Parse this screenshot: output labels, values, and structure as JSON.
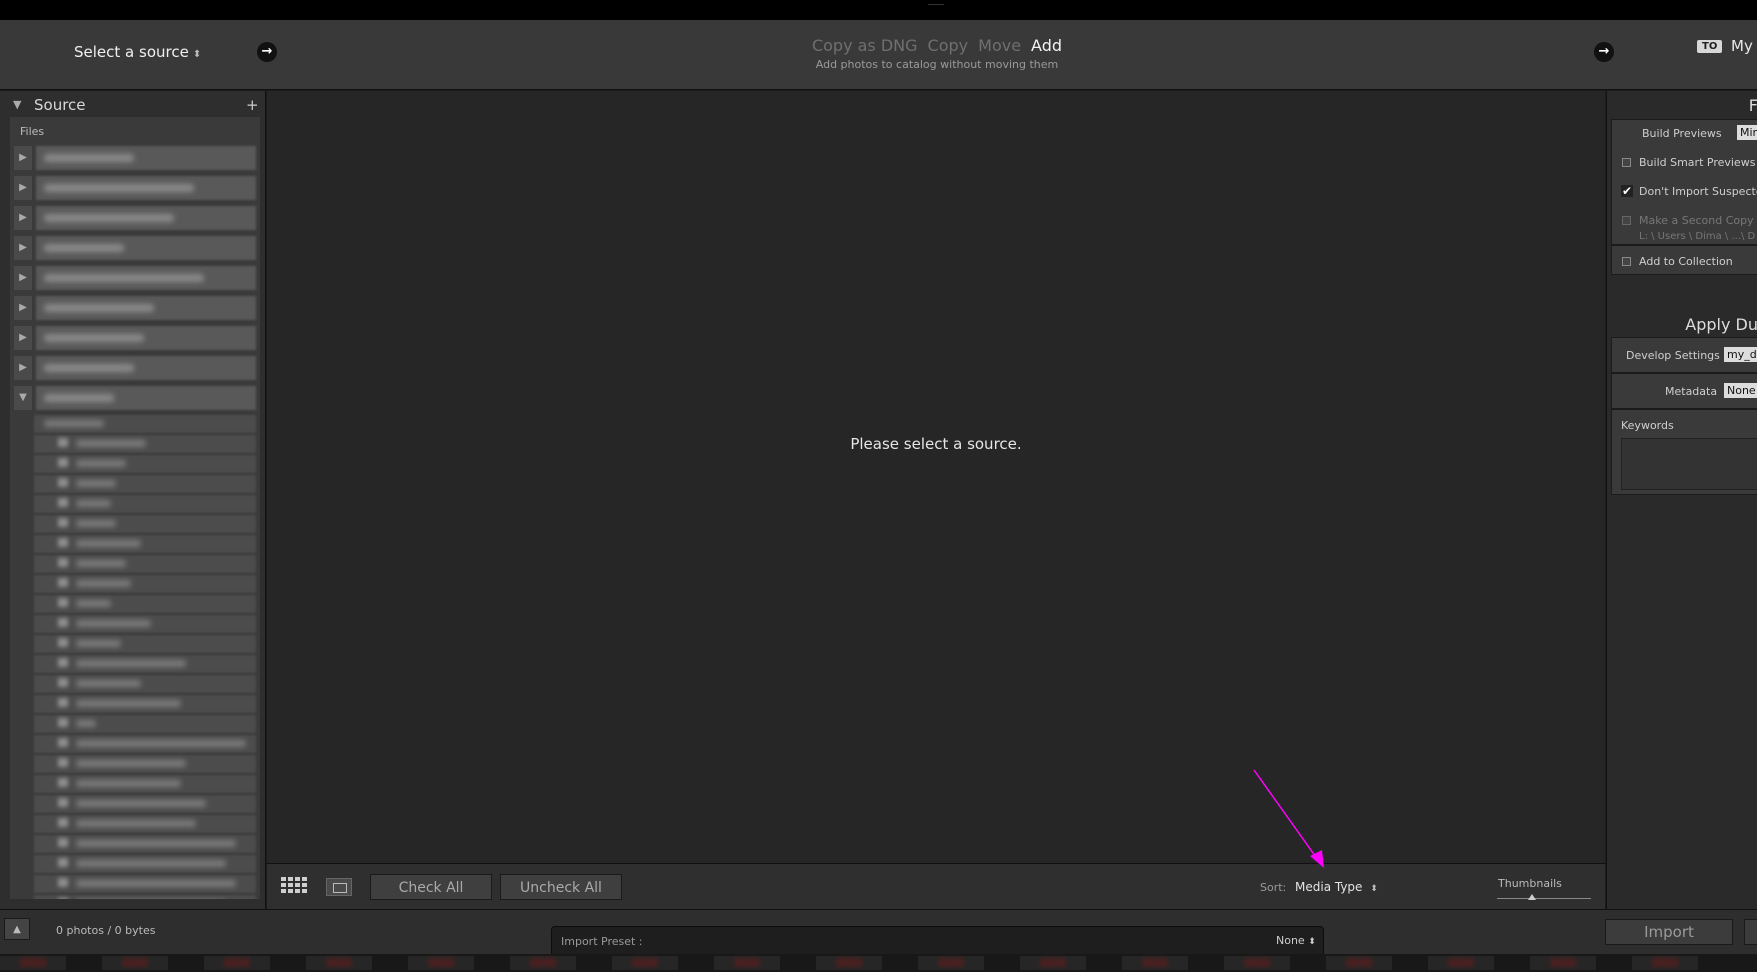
{
  "header": {
    "select_source_label": "Select a source",
    "modes": [
      "Copy as DNG",
      "Copy",
      "Move",
      "Add"
    ],
    "active_mode": "Add",
    "mode_description": "Add photos to catalog without moving them",
    "to_badge": "TO",
    "destination_label": "My C"
  },
  "left_panel": {
    "section_title": "Source",
    "files_label": "Files"
  },
  "center": {
    "message": "Please select a source."
  },
  "toolbar": {
    "check_all": "Check All",
    "uncheck_all": "Uncheck All",
    "sort_label": "Sort:",
    "sort_value": "Media Type",
    "thumbnails_label": "Thumbnails"
  },
  "right_panel": {
    "file_handling_header": "F",
    "build_previews_label": "Build Previews",
    "build_previews_value": "Mini",
    "build_smart_previews": "Build Smart Previews",
    "dont_import_suspected": "Don't Import Suspecte",
    "make_second_copy": "Make a Second Copy T",
    "second_copy_path": "L: \\ Users \\ Dima \\ ...\\ D",
    "add_to_collection": "Add to Collection",
    "apply_header": "Apply Du",
    "develop_settings_label": "Develop Settings",
    "develop_settings_value": "my_d",
    "metadata_label": "Metadata",
    "metadata_value": "None",
    "keywords_label": "Keywords"
  },
  "bottom": {
    "photo_count": "0 photos / 0 bytes",
    "import_preset_label": "Import Preset :",
    "import_preset_value": "None",
    "import_button": "Import"
  },
  "colors": {
    "annotation_arrow": "#ff00ff",
    "background": "#262626"
  }
}
